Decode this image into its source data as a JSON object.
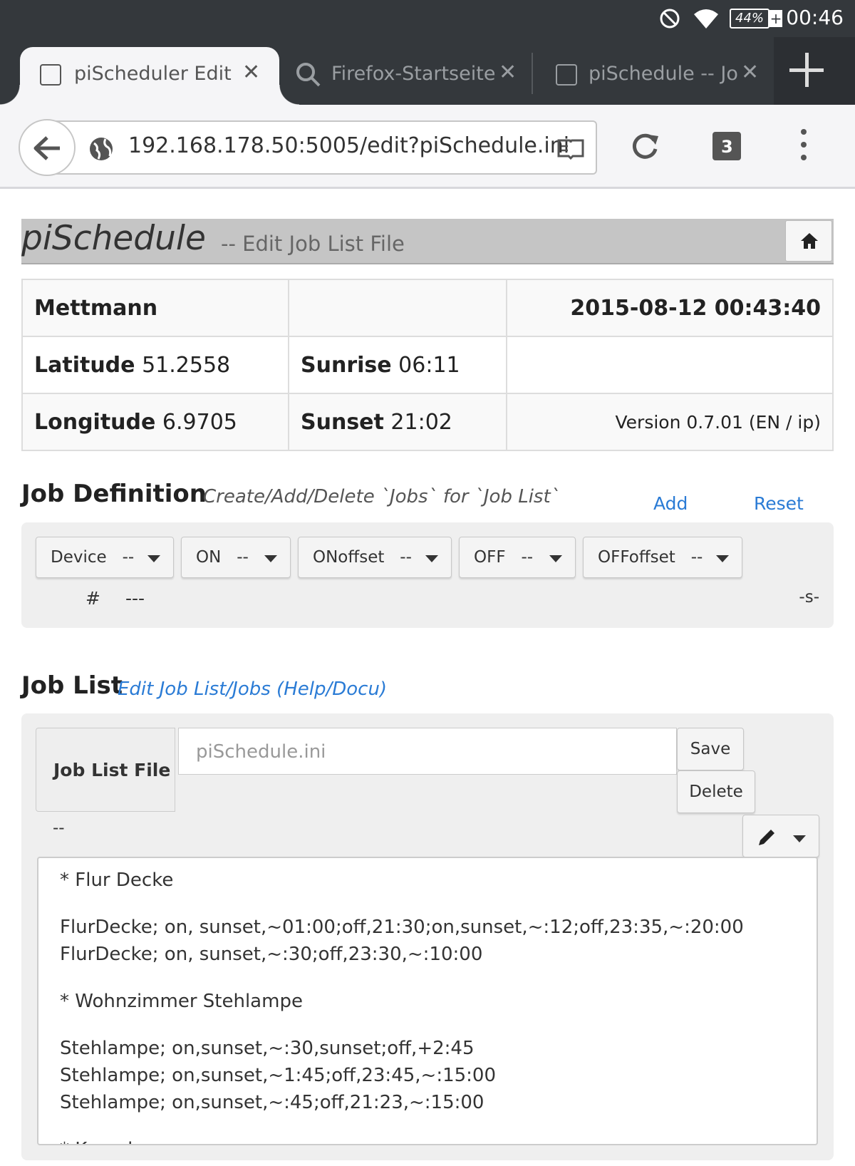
{
  "status_bar": {
    "battery": "44%",
    "time": "00:46",
    "icons": [
      "do-not-disturb-icon",
      "wifi-icon",
      "battery-charging-icon"
    ]
  },
  "tabs": [
    {
      "title": "piScheduler Edit",
      "active": true,
      "icon": "page-icon"
    },
    {
      "title": "Firefox-Startseite",
      "active": false,
      "icon": "search-icon"
    },
    {
      "title": "piSchedule -- Job",
      "active": false,
      "icon": "page-icon"
    }
  ],
  "toolbar": {
    "url": "192.168.178.50:5005/edit?piSchedule.ini",
    "tab_count": "3"
  },
  "header": {
    "brand": "piSchedule",
    "subtitle": "-- Edit Job List File"
  },
  "info_table": {
    "location": "Mettmann",
    "datetime": "2015-08-12 00:43:40",
    "latitude_label": "Latitude",
    "latitude_value": "51.2558",
    "sunrise_label": "Sunrise",
    "sunrise_value": "06:11",
    "longitude_label": "Longitude",
    "longitude_value": "6.9705",
    "sunset_label": "Sunset",
    "sunset_value": "21:02",
    "version": "Version 0.7.01 (EN / ip)"
  },
  "job_definition": {
    "title": "Job Definition",
    "subtitle": "Create/Add/Delete `Jobs` for `Job List`",
    "add_label": "Add",
    "reset_label": "Reset",
    "dropdowns": [
      "Device   --",
      "ON   --",
      "ONoffset   --",
      "OFF   --",
      "OFFoffset   --"
    ],
    "hash": "#",
    "dashes": "---",
    "s_flag": "-s-"
  },
  "job_list": {
    "title": "Job List",
    "help_link": "Edit Job List/Jobs (Help/Docu)",
    "file_label": "Job List File",
    "file_placeholder": "piSchedule.ini",
    "save_label": "Save",
    "delete_label": "Delete",
    "status": "--",
    "editor_lines": [
      "* Flur Decke",
      "FlurDecke; on, sunset,~01:00;off,21:30;on,sunset,~:12;off,23:35,~:20:00",
      "FlurDecke; on, sunset,~:30;off,23:30,~:10:00",
      "* Wohnzimmer Stehlampe",
      "Stehlampe; on,sunset,~:30,sunset;off,+2:45",
      "Stehlampe; on,sunset,~1:45;off,23:45,~:15:00",
      "Stehlampe; on,sunset,~:45;off,21:23,~:15:00",
      "* Kamel"
    ]
  }
}
